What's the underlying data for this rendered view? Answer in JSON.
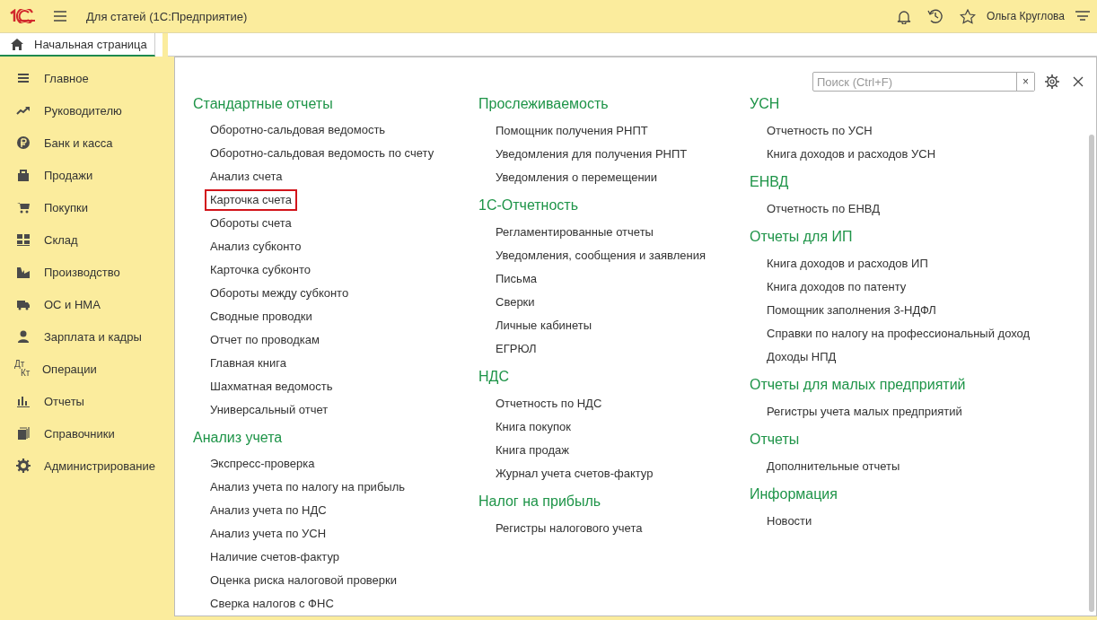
{
  "window": {
    "title": "Для статей  (1С:Предприятие)",
    "user": "Ольга Круглова"
  },
  "tabs": [
    {
      "label": "Начальная страница",
      "selected": true
    }
  ],
  "sidebar": {
    "items": [
      {
        "label": "Главное"
      },
      {
        "label": "Руководителю"
      },
      {
        "label": "Банк и касса"
      },
      {
        "label": "Продажи"
      },
      {
        "label": "Покупки"
      },
      {
        "label": "Склад"
      },
      {
        "label": "Производство"
      },
      {
        "label": "ОС и НМА"
      },
      {
        "label": "Зарплата и кадры"
      },
      {
        "label": "Операции",
        "icon_text": [
          "Дт",
          "Кт"
        ]
      },
      {
        "label": "Отчеты"
      },
      {
        "label": "Справочники"
      },
      {
        "label": "Администрирование"
      }
    ]
  },
  "search": {
    "placeholder": "Поиск (Ctrl+F)",
    "clear": "×"
  },
  "columns": [
    [
      {
        "title": "Стандартные отчеты",
        "links": [
          {
            "label": "Оборотно-сальдовая ведомость",
            "highlighted": false
          },
          {
            "label": "Оборотно-сальдовая ведомость по счету",
            "highlighted": false
          },
          {
            "label": "Анализ счета",
            "highlighted": false
          },
          {
            "label": "Карточка счета",
            "highlighted": true
          },
          {
            "label": "Обороты счета",
            "highlighted": false
          },
          {
            "label": "Анализ субконто",
            "highlighted": false
          },
          {
            "label": "Карточка субконто",
            "highlighted": false
          },
          {
            "label": "Обороты между субконто",
            "highlighted": false
          },
          {
            "label": "Сводные проводки",
            "highlighted": false
          },
          {
            "label": "Отчет по проводкам",
            "highlighted": false
          },
          {
            "label": "Главная книга",
            "highlighted": false
          },
          {
            "label": "Шахматная ведомость",
            "highlighted": false
          },
          {
            "label": "Универсальный отчет",
            "highlighted": false
          }
        ]
      },
      {
        "title": "Анализ учета",
        "links": [
          {
            "label": "Экспресс-проверка",
            "highlighted": false
          },
          {
            "label": "Анализ учета по налогу на прибыль",
            "highlighted": false
          },
          {
            "label": "Анализ учета по НДС",
            "highlighted": false
          },
          {
            "label": "Анализ учета по УСН",
            "highlighted": false
          },
          {
            "label": "Наличие счетов-фактур",
            "highlighted": false
          },
          {
            "label": "Оценка риска налоговой проверки",
            "highlighted": false
          },
          {
            "label": "Сверка налогов с ФНС",
            "highlighted": false
          }
        ]
      }
    ],
    [
      {
        "title": "Прослеживаемость",
        "links": [
          {
            "label": "Помощник получения РНПТ",
            "highlighted": false
          },
          {
            "label": "Уведомления для получения РНПТ",
            "highlighted": false
          },
          {
            "label": "Уведомления о перемещении",
            "highlighted": false
          }
        ]
      },
      {
        "title": "1С-Отчетность",
        "links": [
          {
            "label": "Регламентированные отчеты",
            "highlighted": false
          },
          {
            "label": "Уведомления, сообщения и заявления",
            "highlighted": false
          },
          {
            "label": "Письма",
            "highlighted": false
          },
          {
            "label": "Сверки",
            "highlighted": false
          },
          {
            "label": "Личные кабинеты",
            "highlighted": false
          },
          {
            "label": "ЕГРЮЛ",
            "highlighted": false
          }
        ]
      },
      {
        "title": "НДС",
        "links": [
          {
            "label": "Отчетность по НДС",
            "highlighted": false
          },
          {
            "label": "Книга покупок",
            "highlighted": false
          },
          {
            "label": "Книга продаж",
            "highlighted": false
          },
          {
            "label": "Журнал учета счетов-фактур",
            "highlighted": false
          }
        ]
      },
      {
        "title": "Налог на прибыль",
        "links": [
          {
            "label": "Регистры налогового учета",
            "highlighted": false
          }
        ]
      }
    ],
    [
      {
        "title": "УСН",
        "links": [
          {
            "label": "Отчетность по УСН",
            "highlighted": false
          },
          {
            "label": "Книга доходов и расходов УСН",
            "highlighted": false
          }
        ]
      },
      {
        "title": "ЕНВД",
        "links": [
          {
            "label": "Отчетность по ЕНВД",
            "highlighted": false
          }
        ]
      },
      {
        "title": "Отчеты для ИП",
        "links": [
          {
            "label": "Книга доходов и расходов ИП",
            "highlighted": false
          },
          {
            "label": "Книга доходов по патенту",
            "highlighted": false
          },
          {
            "label": "Помощник заполнения 3-НДФЛ",
            "highlighted": false
          },
          {
            "label": "Справки по налогу на профессиональный доход",
            "highlighted": false
          },
          {
            "label": "Доходы НПД",
            "highlighted": false
          }
        ]
      },
      {
        "title": "Отчеты для малых предприятий",
        "links": [
          {
            "label": "Регистры учета малых предприятий",
            "highlighted": false
          }
        ]
      },
      {
        "title": "Отчеты",
        "links": [
          {
            "label": "Дополнительные отчеты",
            "highlighted": false
          }
        ]
      },
      {
        "title": "Информация",
        "links": [
          {
            "label": "Новости",
            "highlighted": false
          }
        ]
      }
    ]
  ]
}
